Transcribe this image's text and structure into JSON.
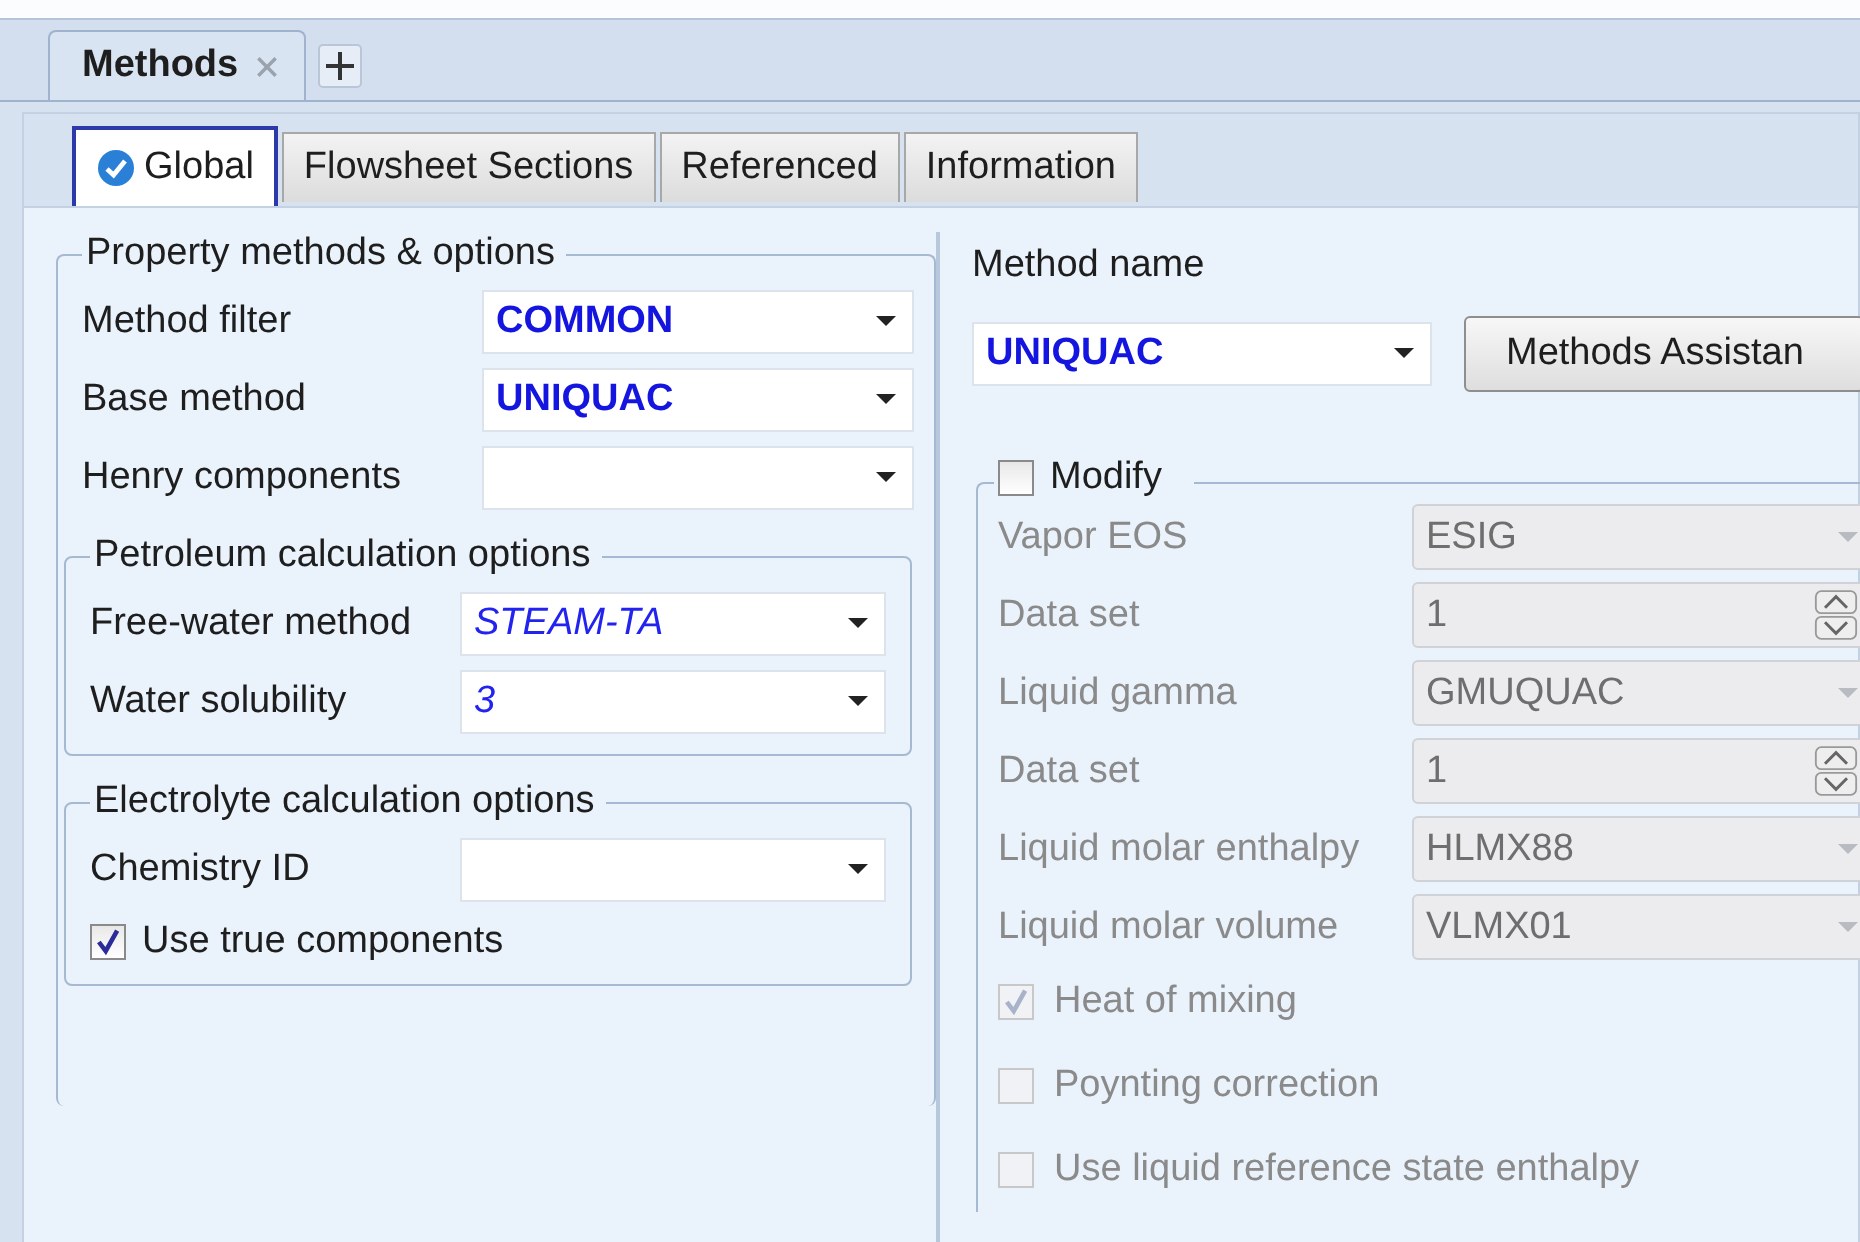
{
  "document_tab": {
    "label": "Methods"
  },
  "tabs": [
    {
      "label": "Global",
      "selected": true,
      "complete": true
    },
    {
      "label": "Flowsheet Sections",
      "selected": false,
      "complete": false
    },
    {
      "label": "Referenced",
      "selected": false,
      "complete": false
    },
    {
      "label": "Information",
      "selected": false,
      "complete": false
    }
  ],
  "property_methods": {
    "title": "Property methods & options",
    "fields": [
      {
        "label": "Method filter",
        "value": "COMMON",
        "bold": true,
        "italic": false
      },
      {
        "label": "Base method",
        "value": "UNIQUAC",
        "bold": true,
        "italic": false
      },
      {
        "label": "Henry components"
      }
    ],
    "petroleum": {
      "title": "Petroleum calculation options",
      "fields": [
        {
          "label": "Free-water method",
          "value": "STEAM-TA",
          "bold": false,
          "italic": true
        },
        {
          "label": "Water solubility",
          "value": "3",
          "bold": false,
          "italic": true
        }
      ]
    },
    "electrolyte": {
      "title": "Electrolyte calculation options",
      "fields": [
        {
          "label": "Chemistry ID"
        }
      ],
      "checkbox": {
        "label": "Use true components",
        "checked": true
      }
    }
  },
  "method": {
    "label": "Method name",
    "value": "UNIQUAC",
    "button": "Methods Assistan",
    "modify": {
      "label": "Modify",
      "checked": false,
      "fields": [
        {
          "kind": "dropdown",
          "label": "Vapor EOS",
          "value": "ESIG",
          "disabled": true
        },
        {
          "kind": "spinner",
          "label": "Data set",
          "value": "1",
          "disabled": true
        },
        {
          "kind": "dropdown",
          "label": "Liquid gamma",
          "value": "GMUQUAC",
          "disabled": true
        },
        {
          "kind": "spinner",
          "label": "Data set",
          "value": "1",
          "disabled": true
        },
        {
          "kind": "dropdown",
          "label": "Liquid molar enthalpy",
          "value": "HLMX88",
          "disabled": true
        },
        {
          "kind": "dropdown",
          "label": "Liquid molar volume",
          "value": "VLMX01",
          "disabled": true
        }
      ],
      "checkboxes": [
        {
          "label": "Heat of mixing",
          "checked": true,
          "disabled": true
        },
        {
          "label": "Poynting correction",
          "checked": false,
          "disabled": true
        },
        {
          "label": "Use liquid reference state enthalpy",
          "checked": false,
          "disabled": true
        }
      ]
    }
  }
}
